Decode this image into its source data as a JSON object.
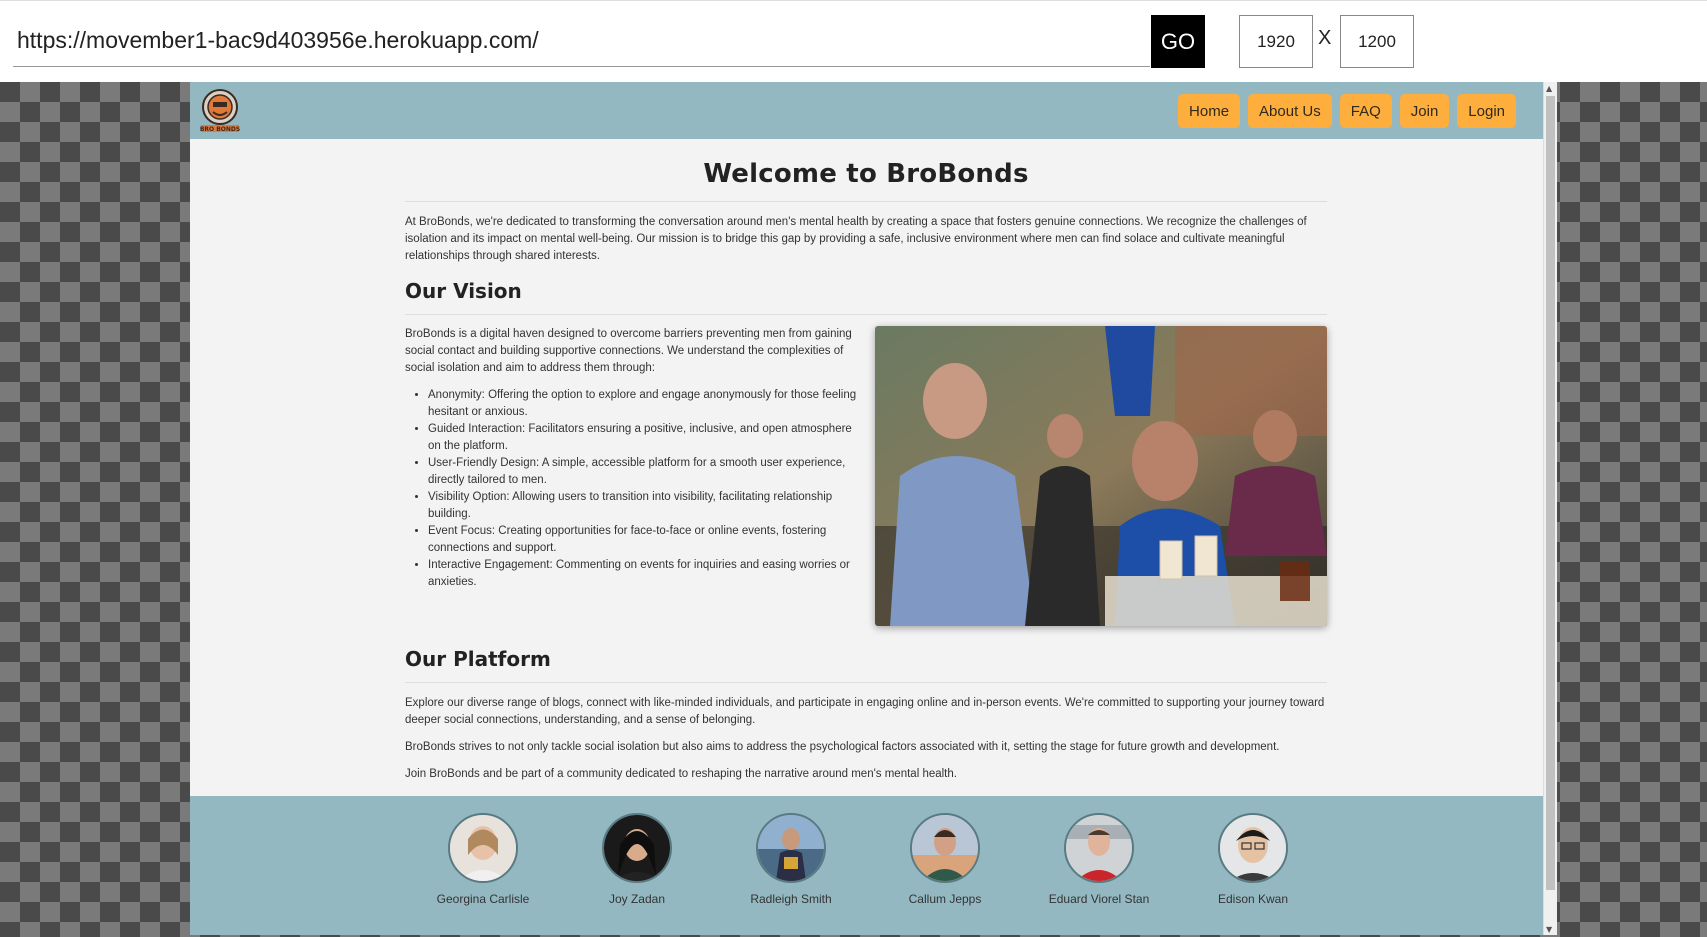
{
  "toolbar": {
    "url": "https://movember1-bac9d403956e.herokuapp.com/",
    "go_label": "GO",
    "width_value": "1920",
    "height_value": "1200",
    "x_label": "X"
  },
  "site": {
    "logo_text": "BRO BONDS",
    "nav": [
      "Home",
      "About Us",
      "FAQ",
      "Join",
      "Login"
    ],
    "title": "Welcome to BroBonds",
    "intro": "At BroBonds, we're dedicated to transforming the conversation around men's mental health by creating a space that fosters genuine connections. We recognize the challenges of isolation and its impact on mental well-being. Our mission is to bridge this gap by providing a safe, inclusive environment where men can find solace and cultivate meaningful relationships through shared interests.",
    "vision": {
      "heading": "Our Vision",
      "text": "BroBonds is a digital haven designed to overcome barriers preventing men from gaining social contact and building supportive connections. We understand the complexities of social isolation and aim to address them through:",
      "items": [
        "Anonymity: Offering the option to explore and engage anonymously for those feeling hesitant or anxious.",
        "Guided Interaction: Facilitators ensuring a positive, inclusive, and open atmosphere on the platform.",
        "User-Friendly Design: A simple, accessible platform for a smooth user experience, directly tailored to men.",
        "Visibility Option: Allowing users to transition into visibility, facilitating relationship building.",
        "Event Focus: Creating opportunities for face-to-face or online events, fostering connections and support.",
        "Interactive Engagement: Commenting on events for inquiries and easing worries or anxieties."
      ]
    },
    "platform": {
      "heading": "Our Platform",
      "p1": "Explore our diverse range of blogs, connect with like-minded individuals, and participate in engaging online and in-person events. We're committed to supporting your journey toward deeper social connections, understanding, and a sense of belonging.",
      "p2": "BroBonds strives to not only tackle social isolation but also aims to address the psychological factors associated with it, setting the stage for future growth and development.",
      "p3": "Join BroBonds and be part of a community dedicated to reshaping the narrative around men's mental health."
    },
    "team": [
      "Georgina Carlisle",
      "Joy Zadan",
      "Radleigh Smith",
      "Callum Jepps",
      "Eduard Viorel Stan",
      "Edison Kwan"
    ]
  },
  "colors": {
    "header_bg": "#94b8c1",
    "nav_button": "#fdae3c",
    "page_bg": "#f3f3f3"
  }
}
